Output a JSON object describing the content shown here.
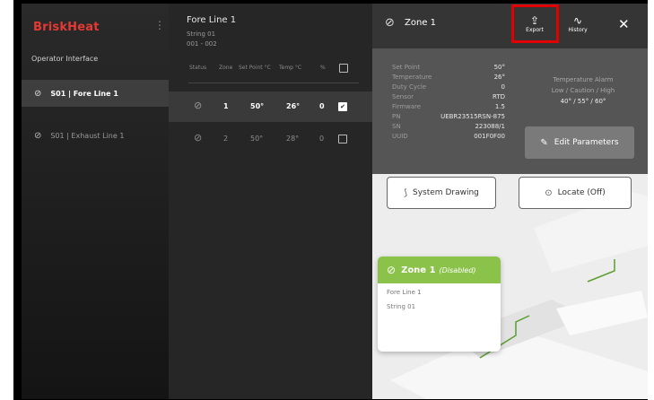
{
  "sidebar": {
    "brand": "BriskHeat",
    "section_title": "Operator Interface",
    "items": [
      {
        "label": "S01 | Fore Line 1",
        "selected": true
      },
      {
        "label": "S01 | Exhaust Line 1",
        "selected": false
      }
    ]
  },
  "middle": {
    "title": "Fore Line 1",
    "subtitle": "String 01",
    "range": "001 - 002",
    "columns": [
      "Status",
      "Zone",
      "Set Point °C",
      "Temp °C",
      "%"
    ],
    "rows": [
      {
        "zone": "1",
        "set_point": "50°",
        "temp": "26°",
        "percent": "0",
        "checked": true,
        "selected": true
      },
      {
        "zone": "2",
        "set_point": "50°",
        "temp": "28°",
        "percent": "0",
        "checked": false,
        "selected": false
      }
    ]
  },
  "detail": {
    "title": "Zone 1",
    "export_label": "Export",
    "history_label": "History",
    "fields": [
      {
        "label": "Set Point",
        "value": "50°"
      },
      {
        "label": "Temperature",
        "value": "26°"
      },
      {
        "label": "Duty Cycle",
        "value": "0"
      },
      {
        "label": "Sensor",
        "value": "RTD"
      },
      {
        "label": "Firmware",
        "value": "1.5"
      },
      {
        "label": "PN",
        "value": "UEBR23515RSN-875"
      },
      {
        "label": "SN",
        "value": "223088/1"
      },
      {
        "label": "UUID",
        "value": "001F0F00"
      }
    ],
    "alarm_title": "Temperature Alarm",
    "alarm_levels": "Low / Caution / High",
    "alarm_values": "40° / 55° / 60°",
    "edit_button": "Edit Parameters",
    "system_drawing_button": "System Drawing",
    "locate_button": "Locate (Off)"
  },
  "card": {
    "title": "Zone 1",
    "status": "(Disabled)",
    "line1": "Fore Line 1",
    "line2": "String 01"
  },
  "colors": {
    "brand": "#e53935",
    "accent_green": "#8bc34a",
    "highlight": "#e00000"
  }
}
